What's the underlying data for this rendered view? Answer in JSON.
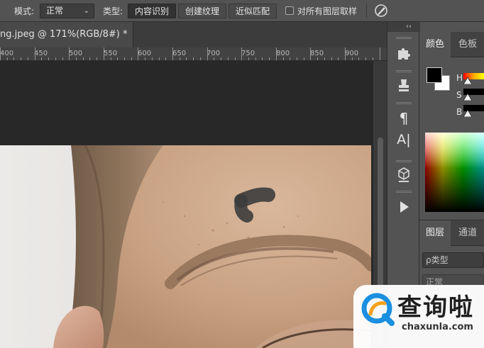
{
  "options_bar": {
    "mode_label": "模式:",
    "mode_value": "正常",
    "type_label": "类型:",
    "type_buttons": [
      "内容识别",
      "创建纹理",
      "近似匹配"
    ],
    "sample_all_layers_label": "对所有图层取样"
  },
  "document": {
    "tab_title": "ng.jpeg @ 171%(RGB/8#) *"
  },
  "ruler": {
    "labels": [
      "400",
      "450",
      "500",
      "550",
      "600",
      "650",
      "700",
      "750",
      "800",
      "850",
      "900"
    ]
  },
  "color_panel": {
    "tabs": [
      "颜色",
      "色板"
    ],
    "channels": [
      "H",
      "S",
      "B"
    ]
  },
  "layers_panel": {
    "tabs": [
      "图层",
      "通道"
    ],
    "filter_placeholder": "ρ类型",
    "blend_mode": "正常"
  },
  "watermark": {
    "title": "查询啦",
    "url": "chaxunla.com"
  },
  "colors": {
    "ui_background": "#535353",
    "pasteboard": "#282828",
    "watermark_accent": "#1b8fe0"
  }
}
